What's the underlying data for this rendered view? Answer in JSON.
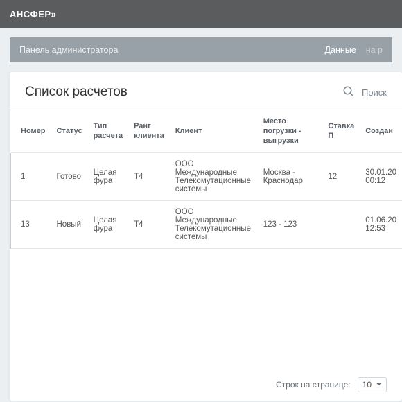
{
  "topbar": {
    "brand": "АНСФЕР»"
  },
  "subbar": {
    "title": "Панель администратора",
    "tabs": [
      {
        "label": "Данные",
        "dim": false
      },
      {
        "label": "на р",
        "dim": true
      }
    ]
  },
  "card": {
    "title": "Список расчетов"
  },
  "search": {
    "placeholder": "Поиск"
  },
  "columns": {
    "num": "Номер",
    "status": "Статус",
    "type": "Тип расчета",
    "rank": "Ранг клиента",
    "client": "Клиент",
    "route": "Место погрузки - выгрузки",
    "rate": "Ставка П",
    "created": "Создан"
  },
  "rows": [
    {
      "num": "1",
      "status": "Готово",
      "type": "Целая фура",
      "rank": "T4",
      "client": "ООО Международные Телекомутационные системы",
      "route": "Москва - Краснодар",
      "rate": "12",
      "created": "30.01.20 00:12"
    },
    {
      "num": "13",
      "status": "Новый",
      "type": "Целая фура",
      "rank": "T4",
      "client": "ООО Международные Телекомутационные системы",
      "route": "123 - 123",
      "rate": "",
      "created": "01.06.20 12:53"
    }
  ],
  "pager": {
    "label": "Строк на странице:",
    "value": "10"
  }
}
